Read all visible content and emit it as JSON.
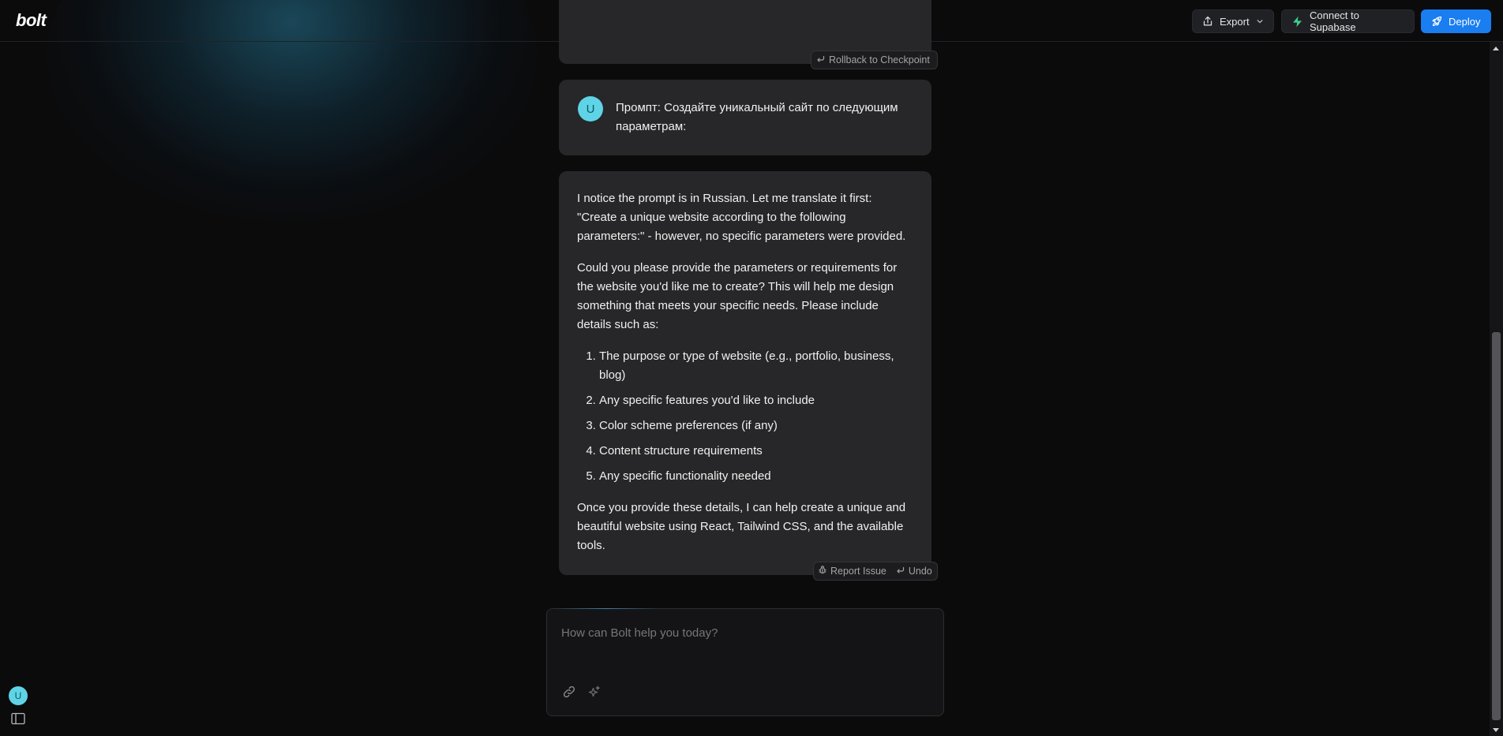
{
  "app": {
    "logo_text": "bolt"
  },
  "header": {
    "export_label": "Export",
    "supabase_label": "Connect to Supabase",
    "deploy_label": "Deploy",
    "accent_color": "#1a7df0",
    "supabase_icon_color": "#3ecf8e"
  },
  "chat": {
    "rollback_label": "Rollback to Checkpoint",
    "user_message": {
      "avatar_initial": "U",
      "text": "Промпт: Создайте уникальный сайт по следующим параметрам:"
    },
    "assistant_message": {
      "intro": "I notice the prompt is in Russian. Let me translate it first: \"Create a unique website according to the following parameters:\" - however, no specific parameters were provided.",
      "request": "Could you please provide the parameters or requirements for the website you'd like me to create? This will help me design something that meets your specific needs. Please include details such as:",
      "items": [
        "The purpose or type of website (e.g., portfolio, business, blog)",
        "Any specific features you'd like to include",
        "Color scheme preferences (if any)",
        "Content structure requirements",
        "Any specific functionality needed"
      ],
      "closing": "Once you provide these details, I can help create a unique and beautiful website using React, Tailwind CSS, and the available tools."
    },
    "report_issue_label": "Report Issue",
    "undo_label": "Undo"
  },
  "input": {
    "placeholder": "How can Bolt help you today?",
    "value": ""
  },
  "sidebar": {
    "user_initial": "U"
  },
  "icons": {
    "export": "export-icon",
    "chevron": "chevron-down-icon",
    "supabase": "supabase-icon",
    "deploy": "rocket-icon",
    "rollback": "return-arrow-icon",
    "report": "bug-icon",
    "undo": "undo-icon",
    "attach": "link-icon",
    "enhance": "sparkles-icon",
    "sidebar": "sidebar-toggle-icon"
  }
}
